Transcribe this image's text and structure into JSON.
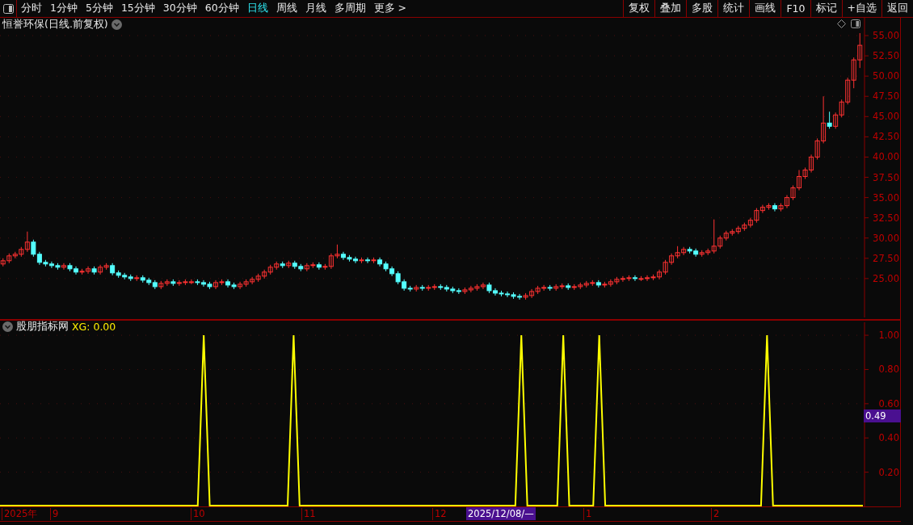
{
  "toolbar": {
    "periods": [
      {
        "label": "分时",
        "selected": false
      },
      {
        "label": "1分钟",
        "selected": false
      },
      {
        "label": "5分钟",
        "selected": false
      },
      {
        "label": "15分钟",
        "selected": false
      },
      {
        "label": "30分钟",
        "selected": false
      },
      {
        "label": "60分钟",
        "selected": false
      },
      {
        "label": "日线",
        "selected": true
      },
      {
        "label": "周线",
        "selected": false
      },
      {
        "label": "月线",
        "selected": false
      },
      {
        "label": "多周期",
        "selected": false
      },
      {
        "label": "更多 >",
        "selected": false
      }
    ],
    "buttons": [
      "复权",
      "叠加",
      "多股",
      "统计",
      "画线",
      "F10",
      "标记",
      "+自选",
      "返回"
    ]
  },
  "price_panel": {
    "title": "恒誉环保(日线.前复权)",
    "chart_data": {
      "type": "candlestick",
      "grid": true,
      "ylim": [
        19.9,
        57.2
      ],
      "yticks": [
        {
          "value": 55,
          "label": "55.00"
        },
        {
          "value": 52.5,
          "label": "52.50"
        },
        {
          "value": 50,
          "label": "50.00"
        },
        {
          "value": 47.5,
          "label": "47.50"
        },
        {
          "value": 45,
          "label": "45.00"
        },
        {
          "value": 42.5,
          "label": "42.50"
        },
        {
          "value": 40,
          "label": "40.00"
        },
        {
          "value": 37.5,
          "label": "37.50"
        },
        {
          "value": 35,
          "label": "35.00"
        },
        {
          "value": 32.5,
          "label": "32.50"
        },
        {
          "value": 30,
          "label": "30.00"
        },
        {
          "value": 27.5,
          "label": "27.50"
        },
        {
          "value": 25,
          "label": "25.00"
        }
      ],
      "categories": [
        null,
        null,
        null,
        null,
        null,
        null,
        null,
        null,
        null,
        null,
        null,
        null,
        null,
        null,
        null,
        null,
        null,
        null,
        null,
        null,
        null,
        null,
        null,
        null,
        null,
        null,
        null,
        null,
        null,
        null,
        null,
        null,
        null,
        null,
        null,
        null,
        null,
        null,
        null,
        null,
        null,
        null,
        null,
        null,
        null,
        null,
        null,
        null,
        null,
        null,
        null,
        null,
        null,
        null,
        null,
        null,
        null,
        null,
        null,
        null,
        null,
        null,
        null,
        null,
        null,
        null,
        null,
        null,
        null,
        null,
        null,
        null,
        null,
        null,
        null,
        null,
        null,
        null,
        null,
        null,
        null,
        null,
        null,
        null,
        null,
        null,
        null,
        null,
        null,
        null,
        null,
        null,
        null,
        null,
        null,
        null,
        null,
        null,
        null,
        null,
        null,
        null,
        null,
        null,
        null,
        null,
        null,
        null,
        null,
        null,
        null,
        null,
        null,
        null,
        null,
        null,
        null,
        null,
        null,
        null,
        null,
        null,
        null,
        null,
        null,
        null,
        null,
        null,
        null,
        null,
        null,
        null,
        null,
        null,
        null,
        null,
        null,
        null,
        null,
        null,
        null,
        null
      ],
      "ohlc": [
        [
          26.8,
          27.5,
          26.5,
          27.2
        ],
        [
          27.2,
          28.1,
          26.9,
          27.8
        ],
        [
          27.8,
          28.3,
          27.5,
          28.0
        ],
        [
          28.0,
          28.9,
          27.7,
          28.6
        ],
        [
          28.6,
          30.8,
          28.3,
          29.5
        ],
        [
          29.5,
          29.8,
          27.7,
          28.0
        ],
        [
          28.0,
          28.3,
          26.7,
          27.0
        ],
        [
          27.0,
          27.3,
          26.5,
          26.8
        ],
        [
          26.8,
          27.1,
          26.3,
          26.6
        ],
        [
          26.6,
          26.9,
          26.1,
          26.4
        ],
        [
          26.4,
          26.9,
          26.1,
          26.6
        ],
        [
          26.6,
          26.9,
          25.9,
          26.2
        ],
        [
          26.2,
          26.5,
          25.5,
          25.8
        ],
        [
          25.8,
          26.2,
          25.5,
          25.9
        ],
        [
          25.9,
          26.5,
          25.6,
          26.2
        ],
        [
          26.2,
          26.5,
          25.5,
          25.8
        ],
        [
          25.8,
          26.7,
          25.5,
          26.4
        ],
        [
          26.4,
          26.9,
          26.1,
          26.6
        ],
        [
          26.6,
          26.9,
          25.4,
          25.7
        ],
        [
          25.7,
          26.0,
          25.1,
          25.4
        ],
        [
          25.4,
          25.7,
          24.9,
          25.2
        ],
        [
          25.2,
          25.5,
          24.7,
          25.0
        ],
        [
          25.0,
          25.4,
          24.7,
          25.1
        ],
        [
          25.1,
          25.4,
          24.5,
          24.8
        ],
        [
          24.8,
          25.1,
          24.2,
          24.5
        ],
        [
          24.5,
          24.8,
          23.7,
          24.0
        ],
        [
          24.0,
          24.7,
          23.7,
          24.4
        ],
        [
          24.4,
          24.9,
          24.1,
          24.6
        ],
        [
          24.6,
          24.9,
          24.1,
          24.4
        ],
        [
          24.4,
          24.8,
          24.1,
          24.5
        ],
        [
          24.5,
          24.9,
          24.2,
          24.6
        ],
        [
          24.6,
          24.9,
          24.3,
          24.6
        ],
        [
          24.6,
          24.9,
          24.2,
          24.5
        ],
        [
          24.5,
          24.8,
          24.0,
          24.3
        ],
        [
          24.3,
          24.6,
          23.7,
          24.0
        ],
        [
          24.0,
          24.8,
          23.7,
          24.5
        ],
        [
          24.5,
          24.9,
          24.2,
          24.6
        ],
        [
          24.6,
          24.9,
          23.9,
          24.2
        ],
        [
          24.2,
          24.5,
          23.7,
          24.0
        ],
        [
          24.0,
          24.6,
          23.7,
          24.3
        ],
        [
          24.3,
          24.9,
          24.0,
          24.6
        ],
        [
          24.6,
          25.2,
          24.3,
          24.9
        ],
        [
          24.9,
          25.6,
          24.6,
          25.3
        ],
        [
          25.3,
          26.1,
          25.0,
          25.8
        ],
        [
          25.8,
          26.7,
          25.5,
          26.4
        ],
        [
          26.4,
          27.1,
          26.1,
          26.8
        ],
        [
          26.8,
          27.1,
          26.3,
          26.6
        ],
        [
          26.6,
          27.2,
          26.3,
          26.9
        ],
        [
          26.9,
          27.2,
          26.2,
          26.5
        ],
        [
          26.5,
          26.8,
          25.9,
          26.2
        ],
        [
          26.2,
          26.9,
          25.9,
          26.6
        ],
        [
          26.6,
          27.0,
          26.3,
          26.7
        ],
        [
          26.7,
          27.0,
          26.1,
          26.4
        ],
        [
          26.4,
          26.8,
          26.1,
          26.5
        ],
        [
          26.5,
          28.1,
          26.2,
          27.8
        ],
        [
          27.8,
          29.2,
          27.5,
          28.0
        ],
        [
          28.0,
          28.3,
          27.3,
          27.6
        ],
        [
          27.6,
          27.9,
          27.1,
          27.4
        ],
        [
          27.4,
          27.7,
          26.9,
          27.2
        ],
        [
          27.2,
          27.6,
          26.9,
          27.3
        ],
        [
          27.3,
          27.6,
          26.9,
          27.2
        ],
        [
          27.2,
          27.6,
          26.9,
          27.3
        ],
        [
          27.3,
          27.6,
          26.5,
          26.8
        ],
        [
          26.8,
          27.1,
          25.9,
          26.2
        ],
        [
          26.2,
          26.5,
          25.3,
          25.6
        ],
        [
          25.6,
          25.9,
          24.3,
          24.6
        ],
        [
          24.6,
          24.9,
          23.5,
          23.8
        ],
        [
          23.8,
          24.1,
          23.4,
          23.7
        ],
        [
          23.7,
          24.2,
          23.4,
          23.9
        ],
        [
          23.9,
          24.2,
          23.5,
          23.8
        ],
        [
          23.8,
          24.2,
          23.5,
          23.9
        ],
        [
          23.9,
          24.3,
          23.6,
          24.0
        ],
        [
          24.0,
          24.3,
          23.6,
          23.9
        ],
        [
          23.9,
          24.2,
          23.4,
          23.7
        ],
        [
          23.7,
          24.0,
          23.2,
          23.5
        ],
        [
          23.5,
          23.8,
          23.1,
          23.4
        ],
        [
          23.4,
          23.9,
          23.1,
          23.6
        ],
        [
          23.6,
          24.1,
          23.3,
          23.8
        ],
        [
          23.8,
          24.3,
          23.5,
          24.0
        ],
        [
          24.0,
          24.5,
          23.7,
          24.2
        ],
        [
          24.2,
          24.5,
          23.2,
          23.5
        ],
        [
          23.5,
          23.8,
          22.9,
          23.2
        ],
        [
          23.2,
          23.5,
          22.8,
          23.1
        ],
        [
          23.1,
          23.4,
          22.7,
          23.0
        ],
        [
          23.0,
          23.3,
          22.5,
          22.8
        ],
        [
          22.8,
          23.1,
          22.4,
          22.7
        ],
        [
          22.7,
          23.2,
          22.4,
          22.9
        ],
        [
          22.9,
          23.7,
          22.6,
          23.4
        ],
        [
          23.4,
          24.1,
          23.1,
          23.8
        ],
        [
          23.8,
          24.2,
          23.5,
          23.9
        ],
        [
          23.9,
          24.2,
          23.5,
          23.8
        ],
        [
          23.8,
          24.3,
          23.5,
          24.0
        ],
        [
          24.0,
          24.4,
          23.7,
          24.1
        ],
        [
          24.1,
          24.4,
          23.6,
          23.9
        ],
        [
          23.9,
          24.3,
          23.6,
          24.0
        ],
        [
          24.0,
          24.5,
          23.7,
          24.2
        ],
        [
          24.2,
          24.7,
          23.9,
          24.4
        ],
        [
          24.4,
          24.8,
          24.1,
          24.5
        ],
        [
          24.5,
          24.8,
          23.9,
          24.2
        ],
        [
          24.2,
          24.6,
          23.9,
          24.3
        ],
        [
          24.3,
          24.9,
          24.0,
          24.6
        ],
        [
          24.6,
          25.2,
          24.3,
          24.9
        ],
        [
          24.9,
          25.3,
          24.6,
          25.0
        ],
        [
          25.0,
          25.4,
          24.7,
          25.1
        ],
        [
          25.1,
          25.4,
          24.7,
          25.0
        ],
        [
          25.0,
          25.3,
          24.7,
          25.0
        ],
        [
          25.0,
          25.4,
          24.7,
          25.1
        ],
        [
          25.1,
          25.5,
          24.8,
          25.2
        ],
        [
          25.2,
          26.1,
          24.9,
          25.8
        ],
        [
          25.8,
          27.3,
          25.5,
          27.0
        ],
        [
          27.0,
          28.1,
          26.7,
          27.8
        ],
        [
          27.8,
          29.0,
          27.5,
          28.2
        ],
        [
          28.2,
          28.9,
          27.9,
          28.6
        ],
        [
          28.6,
          28.9,
          28.1,
          28.4
        ],
        [
          28.4,
          28.7,
          27.7,
          28.0
        ],
        [
          28.0,
          28.5,
          27.7,
          28.2
        ],
        [
          28.2,
          28.7,
          27.9,
          28.4
        ],
        [
          28.4,
          32.3,
          28.1,
          29.0
        ],
        [
          29.0,
          30.3,
          28.7,
          30.0
        ],
        [
          30.0,
          30.9,
          29.7,
          30.6
        ],
        [
          30.6,
          31.1,
          30.3,
          30.8
        ],
        [
          30.8,
          31.5,
          30.5,
          31.2
        ],
        [
          31.2,
          31.9,
          30.9,
          31.6
        ],
        [
          31.6,
          32.5,
          31.3,
          32.2
        ],
        [
          32.2,
          33.7,
          31.9,
          33.4
        ],
        [
          33.4,
          34.1,
          33.1,
          33.8
        ],
        [
          33.8,
          34.3,
          33.5,
          34.0
        ],
        [
          34.0,
          34.3,
          33.3,
          33.6
        ],
        [
          33.6,
          34.3,
          33.3,
          34.0
        ],
        [
          34.0,
          35.3,
          33.7,
          35.0
        ],
        [
          35.0,
          36.5,
          34.7,
          36.2
        ],
        [
          36.2,
          38.4,
          35.9,
          37.6
        ],
        [
          37.6,
          38.7,
          37.3,
          38.4
        ],
        [
          38.4,
          40.3,
          38.1,
          40.0
        ],
        [
          40.0,
          42.3,
          39.7,
          42.0
        ],
        [
          42.0,
          47.5,
          41.7,
          44.2
        ],
        [
          44.2,
          45.6,
          43.5,
          43.8
        ],
        [
          43.8,
          45.5,
          43.5,
          45.2
        ],
        [
          45.2,
          47.1,
          44.9,
          46.8
        ],
        [
          46.8,
          49.8,
          46.5,
          49.5
        ],
        [
          49.5,
          52.3,
          48.5,
          52.0
        ],
        [
          52.0,
          55.3,
          51.0,
          53.8
        ]
      ]
    }
  },
  "indicator_panel": {
    "name": "股朋指标网",
    "readout": "XG: 0.00",
    "chart_data": {
      "type": "line",
      "grid": true,
      "ylim": [
        0,
        1.09
      ],
      "yticks": [
        {
          "value": 1,
          "label": "1.00"
        },
        {
          "value": 0.8,
          "label": "0.80"
        },
        {
          "value": 0.6,
          "label": "0.60"
        },
        {
          "value": 0.4,
          "label": "0.40"
        },
        {
          "value": 0.2,
          "label": "0.20"
        }
      ],
      "values": [
        0,
        0,
        0,
        0,
        0,
        0,
        0,
        0,
        0,
        0,
        0,
        0,
        0,
        0,
        0,
        0,
        0,
        0,
        0,
        0,
        0,
        0,
        0,
        0,
        0,
        0,
        0,
        0,
        0,
        0,
        0,
        0,
        0,
        0,
        1,
        0,
        0,
        0,
        0,
        0,
        0,
        0,
        0,
        0,
        0,
        0,
        0,
        0,
        0,
        1,
        0,
        0,
        0,
        0,
        0,
        0,
        0,
        0,
        0,
        0,
        0,
        0,
        0,
        0,
        0,
        0,
        0,
        0,
        0,
        0,
        0,
        0,
        0,
        0,
        0,
        0,
        0,
        0,
        0,
        0,
        0,
        0,
        0,
        0,
        0,
        0,
        0,
        1,
        0,
        0,
        0,
        0,
        0,
        0,
        1,
        0,
        0,
        0,
        0,
        0,
        1,
        0,
        0,
        0,
        0,
        0,
        0,
        0,
        0,
        0,
        0,
        0,
        0,
        0,
        0,
        0,
        0,
        0,
        0,
        0,
        0,
        0,
        0,
        0,
        0,
        0,
        0,
        0,
        1,
        0,
        0,
        0,
        0,
        0,
        0,
        0,
        0,
        0,
        0,
        0,
        0,
        0,
        0,
        0,
        0
      ]
    },
    "x_axis_labels": [
      "2025年",
      "9",
      "10",
      "11",
      "12",
      "1",
      "2"
    ],
    "cursor": {
      "date": "2025/12/08/—",
      "value": "0.49"
    }
  }
}
